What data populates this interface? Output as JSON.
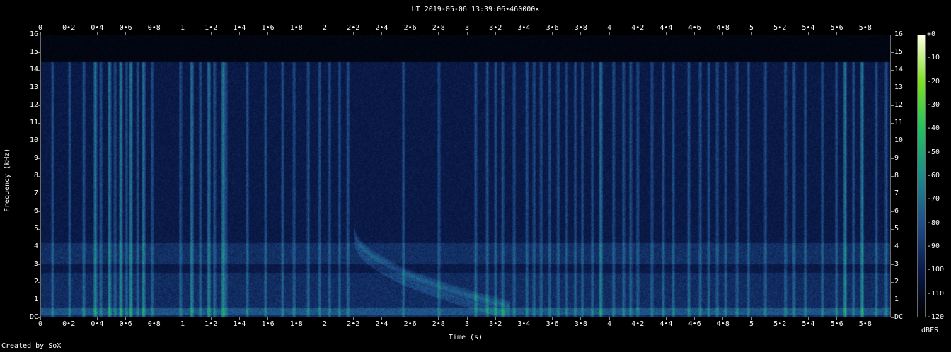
{
  "chart_data": {
    "type": "heatmap",
    "title": "UT 2019-05-06 13:39:06•460000×",
    "xlabel": "Time (s)",
    "ylabel": "Frequency (kHz)",
    "credit": "Created by SoX",
    "xlim": [
      0,
      5.98
    ],
    "ylim": [
      0,
      16
    ],
    "x_ticks": [
      "0",
      "0•2",
      "0•4",
      "0•6",
      "0•8",
      "1",
      "1•2",
      "1•4",
      "1•6",
      "1•8",
      "2",
      "2•2",
      "2•4",
      "2•6",
      "2•8",
      "3",
      "3•2",
      "3•4",
      "3•6",
      "3•8",
      "4",
      "4•2",
      "4•4",
      "4•6",
      "4•8",
      "5",
      "5•2",
      "5•4",
      "5•6",
      "5•8"
    ],
    "y_ticks": [
      "DC",
      "1",
      "2",
      "3",
      "4",
      "5",
      "6",
      "7",
      "8",
      "9",
      "10",
      "11",
      "12",
      "13",
      "14",
      "15",
      "16"
    ],
    "colorbar": {
      "unit": "dBFS",
      "ticks": [
        "+0",
        "-10",
        "-20",
        "-30",
        "-40",
        "-50",
        "-60",
        "-70",
        "-80",
        "-90",
        "-100",
        "-110",
        "-120"
      ],
      "range": [
        -120,
        0
      ],
      "colors": [
        "#000000",
        "#0a1a4a",
        "#1f4f8a",
        "#1d8a8a",
        "#22c060",
        "#7ae020",
        "#ffffe0"
      ]
    },
    "features": {
      "max_frequency_khz": 14.5,
      "noise_band_khz": [
        3.0,
        4.2
      ],
      "low_band_khz": [
        0.1,
        0.5
      ],
      "sweep": {
        "t_start": 2.2,
        "f_start_khz": 5.0,
        "t_end": 3.3,
        "f_end_khz": 0.6
      },
      "strong_transients_s": [
        0.38,
        0.48,
        0.56,
        0.63,
        0.72,
        1.06,
        1.18,
        1.28,
        3.94,
        5.66,
        5.78
      ],
      "transients_s": [
        0.08,
        0.2,
        0.3,
        0.42,
        0.52,
        0.6,
        0.68,
        0.78,
        0.98,
        1.12,
        1.22,
        1.3,
        1.45,
        1.58,
        1.7,
        1.78,
        1.88,
        1.96,
        2.03,
        2.1,
        2.16,
        2.55,
        2.8,
        3.06,
        3.14,
        3.2,
        3.25,
        3.33,
        3.42,
        3.47,
        3.52,
        3.58,
        3.64,
        3.7,
        3.76,
        3.81,
        3.88,
        4.03,
        4.1,
        4.15,
        4.2,
        4.3,
        4.38,
        4.45,
        4.56,
        4.64,
        4.7,
        4.76,
        4.82,
        4.9,
        4.98,
        5.1,
        5.24,
        5.3,
        5.38,
        5.5,
        5.6,
        5.72,
        5.88,
        5.95
      ]
    }
  }
}
